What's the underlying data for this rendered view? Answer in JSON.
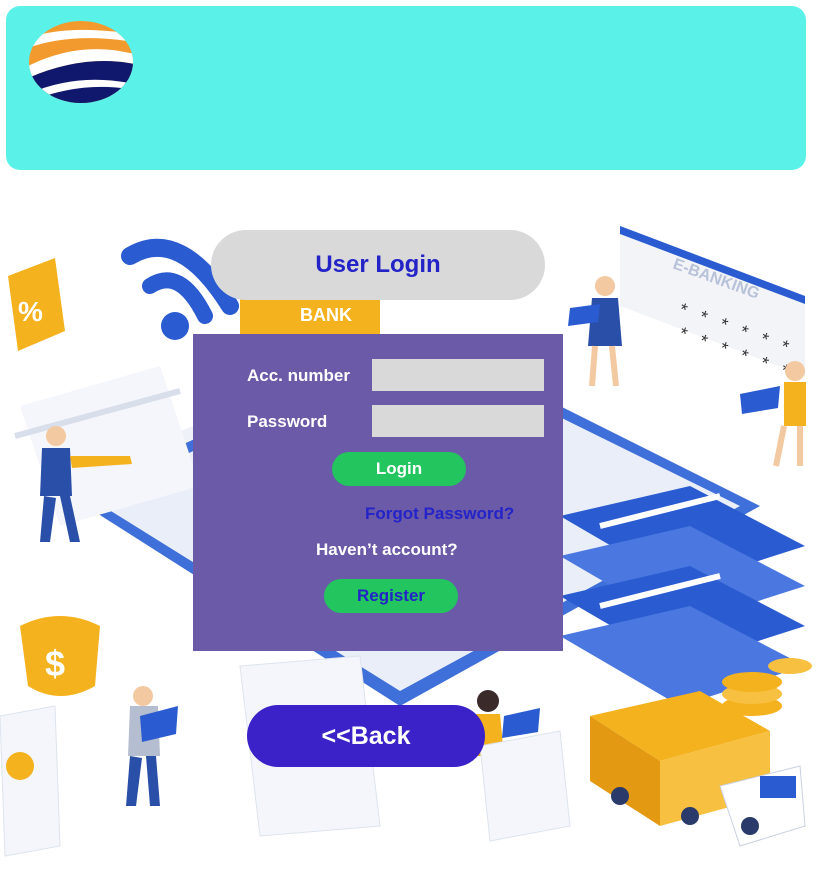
{
  "header": {
    "logo_icon": "globe-waves-logo"
  },
  "login": {
    "title": "User Login",
    "acc_label": "Acc. number",
    "acc_value": "",
    "password_label": "Password",
    "password_value": "",
    "login_button": "Login",
    "forgot_link": "Forgot Password?",
    "no_account_text": "Haven’t account?",
    "register_button": "Register"
  },
  "back_button": "<<Back",
  "background": {
    "illustration_text": "E-BANKING",
    "bank_sign": "BANK"
  },
  "colors": {
    "header": "#5af2e8",
    "panel": "#6b5aa8",
    "green_button": "#22c55e",
    "back_button": "#3b22c8",
    "title_text": "#2323c8"
  }
}
